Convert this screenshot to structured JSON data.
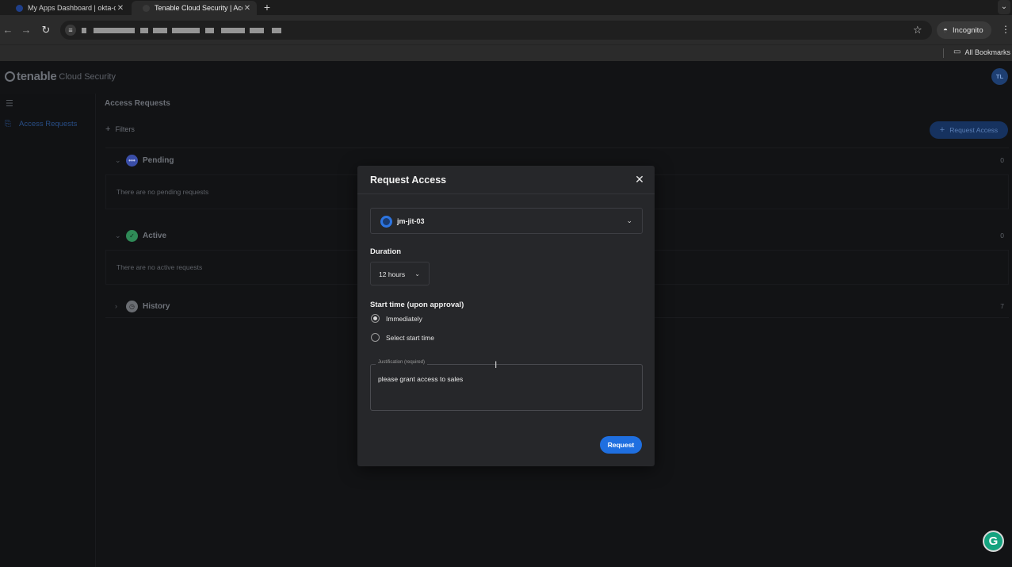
{
  "browser": {
    "tabs": [
      {
        "title": "My Apps Dashboard | okta-de",
        "favicon_color": "#1f3f8a",
        "active": false
      },
      {
        "title": "Tenable Cloud Security | Acc",
        "favicon_color": "#2a2a2a",
        "active": true
      }
    ],
    "new_tab_icon": "+",
    "incognito_label": "Incognito",
    "bookmarks_label": "All Bookmarks"
  },
  "app": {
    "brand": "tenable",
    "brand_sub": "Cloud Security",
    "avatar_initials": "TL",
    "sidebar": {
      "items": [
        {
          "label": "Access Requests",
          "icon": "access-requests-icon"
        }
      ]
    },
    "page_title": "Access Requests",
    "filters_label": "Filters",
    "request_access_button": "Request Access",
    "sections": [
      {
        "label": "Pending",
        "count": "0",
        "empty_text": "There are no pending requests",
        "icon_color": "#3a4ea8",
        "expanded": true
      },
      {
        "label": "Active",
        "count": "0",
        "empty_text": "There are no active requests",
        "icon_color": "#2f8a57",
        "expanded": true
      },
      {
        "label": "History",
        "count": "7",
        "empty_text": "",
        "icon_color": "#6a6d72",
        "expanded": false
      }
    ]
  },
  "modal": {
    "title": "Request Access",
    "account_value": "jm-jit-03",
    "duration_label": "Duration",
    "duration_value": "12 hours",
    "start_label": "Start time (upon approval)",
    "start_options": [
      {
        "label": "Immediately",
        "selected": true
      },
      {
        "label": "Select start time",
        "selected": false
      }
    ],
    "justification_label": "Justification (required)",
    "justification_value": "please grant access to sales",
    "submit_label": "Request"
  },
  "colors": {
    "primary": "#1f6fe0",
    "modal_bg": "#26272a",
    "page_bg": "#121315"
  }
}
